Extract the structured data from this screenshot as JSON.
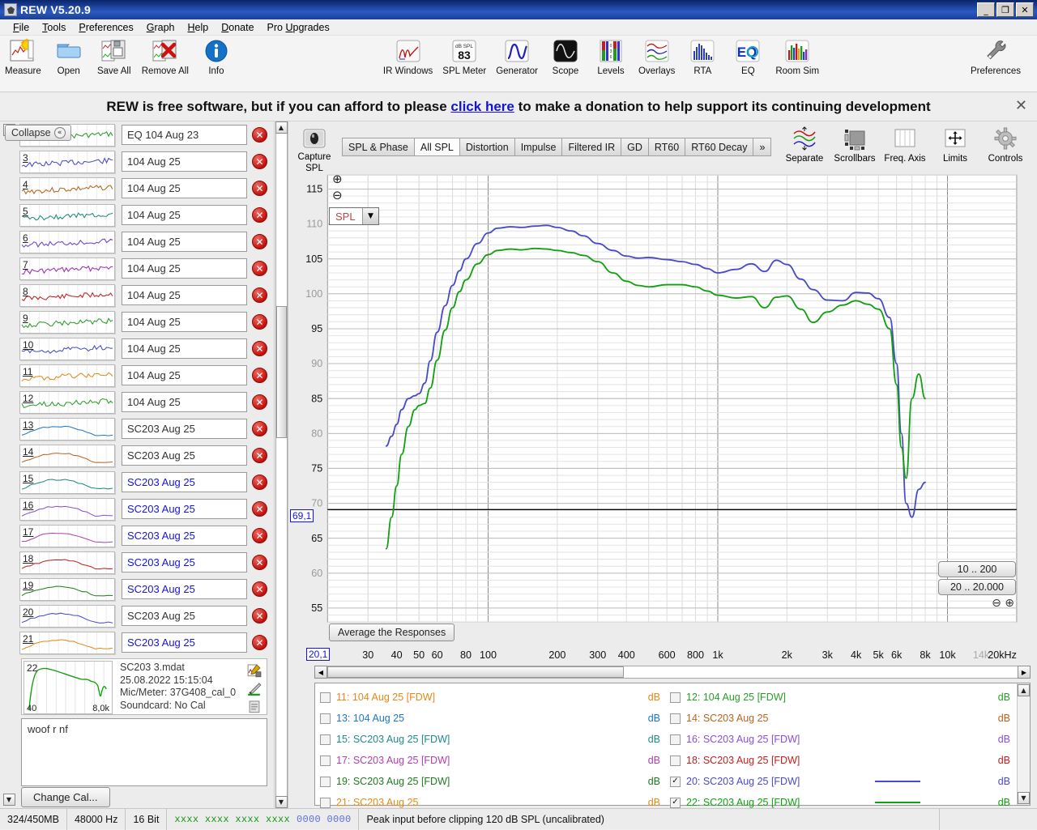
{
  "window": {
    "title": "REW V5.20.9",
    "minimize": "_",
    "restore": "❐",
    "close": "✕"
  },
  "menu": [
    "File",
    "Tools",
    "Preferences",
    "Graph",
    "Help",
    "Donate",
    "Pro Upgrades"
  ],
  "toolbar": {
    "left": [
      {
        "label": "Measure",
        "icon": "measure-icon"
      },
      {
        "label": "Open",
        "icon": "folder-icon"
      },
      {
        "label": "Save All",
        "icon": "save-icon"
      },
      {
        "label": "Remove All",
        "icon": "remove-icon"
      },
      {
        "label": "Info",
        "icon": "info-icon"
      }
    ],
    "center": [
      {
        "label": "IR Windows",
        "icon": "ir-windows-icon"
      },
      {
        "label": "SPL Meter",
        "icon": "spl-meter-icon",
        "value": "83",
        "unit": "dB SPL"
      },
      {
        "label": "Generator",
        "icon": "generator-icon"
      },
      {
        "label": "Scope",
        "icon": "scope-icon"
      },
      {
        "label": "Levels",
        "icon": "levels-icon"
      },
      {
        "label": "Overlays",
        "icon": "overlays-icon"
      },
      {
        "label": "RTA",
        "icon": "rta-icon"
      },
      {
        "label": "EQ",
        "icon": "eq-icon"
      },
      {
        "label": "Room Sim",
        "icon": "room-sim-icon"
      }
    ],
    "right": [
      {
        "label": "Preferences",
        "icon": "wrench-icon"
      }
    ]
  },
  "banner": {
    "text_before": "REW is free software, but if you can afford to please ",
    "link": "click here",
    "text_after": " to make a donation to help support its continuing development",
    "close": "✕"
  },
  "sidebar": {
    "collapse_label": "Collapse",
    "collapse_icon": "«",
    "measurements": [
      {
        "num": "",
        "name": "EQ 104 Aug 23",
        "color": "#2a9d2a",
        "selected": false,
        "partial": true
      },
      {
        "num": "3",
        "name": "104 Aug 25",
        "color": "#4a4ac8",
        "selected": false
      },
      {
        "num": "4",
        "name": "104 Aug 25",
        "color": "#b5651d",
        "selected": false
      },
      {
        "num": "5",
        "name": "104 Aug 25",
        "color": "#1f8a7a",
        "selected": false
      },
      {
        "num": "6",
        "name": "104 Aug 25",
        "color": "#6b3fd6",
        "selected": false
      },
      {
        "num": "7",
        "name": "104 Aug 25",
        "color": "#9b2fae",
        "selected": false
      },
      {
        "num": "8",
        "name": "104 Aug 25",
        "color": "#c02020",
        "selected": false
      },
      {
        "num": "9",
        "name": "104 Aug 25",
        "color": "#2a9d2a",
        "selected": false
      },
      {
        "num": "10",
        "name": "104 Aug 25",
        "color": "#4a4ac8",
        "selected": false
      },
      {
        "num": "11",
        "name": "104 Aug 25",
        "color": "#e08a18",
        "selected": false
      },
      {
        "num": "12",
        "name": "104 Aug 25",
        "color": "#2a9d2a",
        "selected": false
      },
      {
        "num": "13",
        "name": "SC203 Aug 25",
        "color": "#1f77c4",
        "selected": false
      },
      {
        "num": "14",
        "name": "SC203 Aug 25",
        "color": "#b5651d",
        "selected": false
      },
      {
        "num": "15",
        "name": "SC203 Aug 25",
        "color": "#1f8a7a",
        "selected": true
      },
      {
        "num": "16",
        "name": "SC203 Aug 25",
        "color": "#8a4fd6",
        "selected": true
      },
      {
        "num": "17",
        "name": "SC203 Aug 25",
        "color": "#b03fb0",
        "selected": true
      },
      {
        "num": "18",
        "name": "SC203 Aug 25",
        "color": "#c02020",
        "selected": true
      },
      {
        "num": "19",
        "name": "SC203 Aug 25",
        "color": "#1f7a1f",
        "selected": true
      },
      {
        "num": "20",
        "name": "SC203 Aug 25",
        "color": "#4a4ac8",
        "selected": false
      },
      {
        "num": "21",
        "name": "SC203 Aug 25",
        "color": "#e08a18",
        "selected": true
      }
    ],
    "detail": {
      "num": "22",
      "color": "#11a011",
      "axis_low": "40",
      "axis_high": "8,0k",
      "file": "SC203 3.mdat",
      "timestamp": "25.08.2022 15:15:04",
      "mic": "Mic/Meter: 37G408_cal_0",
      "soundcard": "Soundcard: No Cal",
      "icons": [
        "save-edit-icon",
        "pencil-color-icon",
        "notes-icon"
      ]
    },
    "notes": "woof r nf",
    "change_cal_label": "Change Cal..."
  },
  "graph": {
    "capture_label": "Capture",
    "capture_sublabel": "SPL",
    "tabs": [
      {
        "label": "SPL & Phase",
        "active": false
      },
      {
        "label": "All SPL",
        "active": true
      },
      {
        "label": "Distortion",
        "active": false
      },
      {
        "label": "Impulse",
        "active": false
      },
      {
        "label": "Filtered IR",
        "active": false
      },
      {
        "label": "GD",
        "active": false
      },
      {
        "label": "RT60",
        "active": false
      },
      {
        "label": "RT60 Decay",
        "active": false
      },
      {
        "label": "»",
        "active": false
      }
    ],
    "right_tools": [
      {
        "label": "Separate",
        "icon": "separate-icon"
      },
      {
        "label": "Scrollbars",
        "icon": "scrollbars-icon"
      },
      {
        "label": "Freq. Axis",
        "icon": "freq-axis-icon"
      },
      {
        "label": "Limits",
        "icon": "limits-icon"
      },
      {
        "label": "Controls",
        "icon": "controls-gear-icon"
      }
    ],
    "axis_select": "SPL",
    "zoom_in_icon": "⊕",
    "zoom_out_icon": "⊖",
    "average_button": "Average the Responses",
    "range_buttons": [
      "10 .. 200",
      "20 .. 20.000"
    ],
    "range_zoom_out": "⊖",
    "range_zoom_in": "⊕",
    "cursor_y": "69,1",
    "cursor_x": "20,1"
  },
  "chart_data": {
    "type": "line",
    "title": "All SPL",
    "xlabel": "",
    "ylabel": "SPL",
    "xscale": "log",
    "xlim": [
      20,
      20000
    ],
    "ylim": [
      53,
      117
    ],
    "yticks": [
      115,
      110,
      105,
      100,
      95,
      90,
      85,
      80,
      75,
      70,
      65,
      60,
      55
    ],
    "xticks": [
      "20,1",
      "30",
      "40",
      "50",
      "60",
      "80",
      "100",
      "200",
      "300",
      "400",
      "600",
      "800",
      "1k",
      "2k",
      "3k",
      "4k",
      "5k",
      "6k",
      "8k",
      "10k",
      "14k",
      "20kHz"
    ],
    "grid": true,
    "legend_position": "below",
    "cursor_line_y": 69.1,
    "series": [
      {
        "name": "20: SC203 Aug 25 [FDW]",
        "color": "#4a4ac8",
        "unit": "dB",
        "x": [
          36,
          38,
          40,
          42,
          45,
          48,
          50,
          53,
          56,
          60,
          65,
          70,
          75,
          80,
          90,
          100,
          110,
          125,
          140,
          160,
          180,
          200,
          230,
          260,
          300,
          350,
          400,
          450,
          500,
          600,
          700,
          800,
          900,
          1000,
          1200,
          1400,
          1600,
          1800,
          2000,
          2300,
          2600,
          3000,
          3500,
          4000,
          4500,
          5000,
          5600,
          6000,
          6300,
          6600,
          7000,
          7500,
          8000
        ],
        "y": [
          78.2,
          79.6,
          81.3,
          83.4,
          85.0,
          85.4,
          85.7,
          87.2,
          90.4,
          94.5,
          98.3,
          101.2,
          103.3,
          105.0,
          107.2,
          108.7,
          109.4,
          109.6,
          109.5,
          109.7,
          109.8,
          109.5,
          109.0,
          108.3,
          107.2,
          106.2,
          105.4,
          105.1,
          105.2,
          104.9,
          104.6,
          104.2,
          103.6,
          103.0,
          103.5,
          104.3,
          103.2,
          104.8,
          104.2,
          102.1,
          100.6,
          99.1,
          99.0,
          100.2,
          100.1,
          99.3,
          96.6,
          90.0,
          80.0,
          70.0,
          68.0,
          72.0,
          73.0
        ]
      },
      {
        "name": "22: SC203 Aug 25 [FDW]",
        "color": "#11a011",
        "unit": "dB",
        "x": [
          36,
          38,
          40,
          42,
          45,
          48,
          50,
          53,
          56,
          60,
          65,
          70,
          75,
          80,
          90,
          100,
          110,
          125,
          140,
          160,
          180,
          200,
          230,
          260,
          300,
          350,
          400,
          450,
          500,
          600,
          700,
          800,
          900,
          1000,
          1200,
          1400,
          1600,
          1800,
          2000,
          2300,
          2600,
          3000,
          3500,
          4000,
          4500,
          5000,
          5600,
          6000,
          6300,
          6600,
          7000,
          7500,
          8000
        ],
        "y": [
          63.5,
          68.0,
          72.5,
          77.0,
          81.0,
          83.4,
          84.0,
          84.3,
          86.5,
          90.5,
          94.8,
          98.0,
          100.3,
          102.0,
          104.3,
          105.6,
          106.2,
          106.4,
          106.3,
          106.5,
          106.4,
          106.2,
          105.9,
          105.5,
          104.6,
          103.0,
          101.8,
          101.2,
          101.0,
          101.3,
          101.3,
          101.0,
          100.4,
          99.8,
          99.4,
          99.6,
          98.0,
          99.5,
          99.7,
          97.8,
          95.9,
          97.4,
          98.4,
          99.0,
          98.5,
          97.8,
          95.0,
          87.0,
          78.0,
          73.6,
          85.0,
          88.5,
          85.0
        ]
      }
    ]
  },
  "legend": [
    {
      "num": "11",
      "label": "11: 104 Aug 25 [FDW]",
      "color": "#e08a18",
      "checked": false,
      "unit": "dB",
      "line": false
    },
    {
      "num": "12",
      "label": "12: 104 Aug 25 [FDW]",
      "color": "#2a9d2a",
      "checked": false,
      "unit": "dB",
      "line": false
    },
    {
      "num": "13",
      "label": "13: 104 Aug 25",
      "color": "#1f77c4",
      "checked": false,
      "unit": "dB",
      "line": false
    },
    {
      "num": "14",
      "label": "14: SC203 Aug 25",
      "color": "#b5651d",
      "checked": false,
      "unit": "dB",
      "line": false
    },
    {
      "num": "15",
      "label": "15: SC203 Aug 25 [FDW]",
      "color": "#1f8a8a",
      "checked": false,
      "unit": "dB",
      "line": false
    },
    {
      "num": "16",
      "label": "16: SC203 Aug 25 [FDW]",
      "color": "#8a4fd6",
      "checked": false,
      "unit": "dB",
      "line": false
    },
    {
      "num": "17",
      "label": "17: SC203 Aug 25 [FDW]",
      "color": "#b03fb0",
      "checked": false,
      "unit": "dB",
      "line": false
    },
    {
      "num": "18",
      "label": "18: SC203 Aug 25 [FDW]",
      "color": "#c02020",
      "checked": false,
      "unit": "dB",
      "line": false
    },
    {
      "num": "19",
      "label": "19: SC203 Aug 25 [FDW]",
      "color": "#1f7a1f",
      "checked": false,
      "unit": "dB",
      "line": false
    },
    {
      "num": "20",
      "label": "20: SC203 Aug 25 [FDW]",
      "color": "#4a4ac8",
      "checked": true,
      "unit": "dB",
      "line": true
    },
    {
      "num": "21",
      "label": "21: SC203 Aug 25",
      "color": "#e08a18",
      "checked": false,
      "unit": "dB",
      "line": false
    },
    {
      "num": "22",
      "label": "22: SC203 Aug 25 [FDW]",
      "color": "#11a011",
      "checked": true,
      "unit": "dB",
      "line": true
    }
  ],
  "statusbar": {
    "memory": "324/450MB",
    "samplerate": "48000 Hz",
    "bitdepth": "16 Bit",
    "meter_green": "xxxx xxxx  xxxx xxxx",
    "meter_blue": "0000 0000",
    "peak_text": "Peak input before clipping 120 dB SPL (uncalibrated)"
  }
}
